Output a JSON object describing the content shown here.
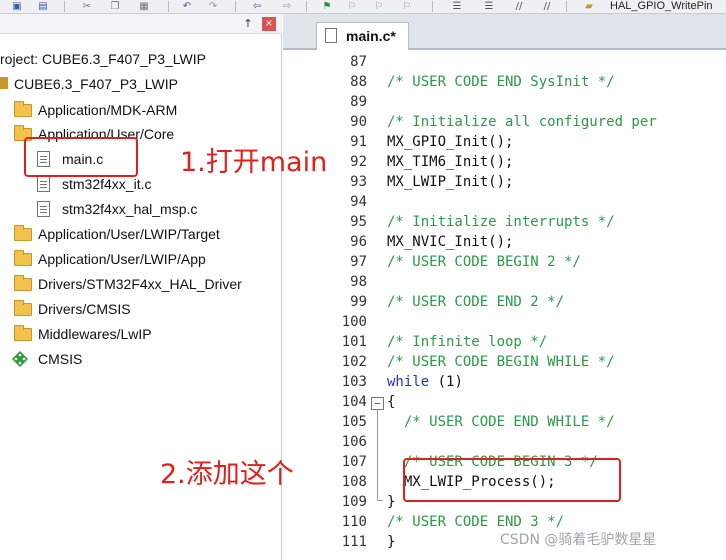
{
  "toolbar": {
    "function_label": "HAL_GPIO_WritePin",
    "icons": [
      "save-icon",
      "save-all-icon",
      "cut-icon",
      "copy-icon",
      "paste-icon",
      "undo-icon",
      "redo-icon",
      "nav-back-icon",
      "nav-forward-icon",
      "bookmark-icon",
      "bookmark-prev-icon",
      "bookmark-next-icon",
      "bookmark-clear-icon",
      "indent-icon",
      "unindent-icon",
      "comment-icon",
      "uncomment-icon",
      "find-in-files-icon"
    ]
  },
  "project_pane": {
    "pin_glyph": "↑",
    "close_glyph": "×",
    "project_title": "roject: CUBE6.3_F407_P3_LWIP",
    "target_name": "CUBE6.3_F407_P3_LWIP",
    "groups": [
      {
        "label": "Application/MDK-ARM"
      },
      {
        "label": "Application/User/Core"
      },
      {
        "label": "Application/User/LWIP/Target"
      },
      {
        "label": "Application/User/LWIP/App"
      },
      {
        "label": "Drivers/STM32F4xx_HAL_Driver"
      },
      {
        "label": "Drivers/CMSIS"
      },
      {
        "label": "Middlewares/LwIP"
      }
    ],
    "core_files": [
      {
        "label": "main.c"
      },
      {
        "label": "stm32f4xx_it.c"
      },
      {
        "label": "stm32f4xx_hal_msp.c"
      }
    ],
    "cmsis_label": "CMSIS"
  },
  "annotations": {
    "step1": "1.打开main",
    "step2": "2.添加这个"
  },
  "editor": {
    "active_tab": "main.c*",
    "fold_glyph": "−",
    "lines": [
      {
        "num": "87",
        "code": ""
      },
      {
        "num": "88",
        "code": "/* USER CODE END SysInit */"
      },
      {
        "num": "89",
        "code": ""
      },
      {
        "num": "90",
        "code": "/* Initialize all configured per"
      },
      {
        "num": "91",
        "code": "MX_GPIO_Init();"
      },
      {
        "num": "92",
        "code": "MX_TIM6_Init();"
      },
      {
        "num": "93",
        "code": "MX_LWIP_Init();"
      },
      {
        "num": "94",
        "code": ""
      },
      {
        "num": "95",
        "code": "/* Initialize interrupts */"
      },
      {
        "num": "96",
        "code": "MX_NVIC_Init();"
      },
      {
        "num": "97",
        "code": "/* USER CODE BEGIN 2 */"
      },
      {
        "num": "98",
        "code": ""
      },
      {
        "num": "99",
        "code": "/* USER CODE END 2 */"
      },
      {
        "num": "100",
        "code": ""
      },
      {
        "num": "101",
        "code": "/* Infinite loop */"
      },
      {
        "num": "102",
        "code": "/* USER CODE BEGIN WHILE */"
      },
      {
        "num": "103",
        "code": "while (1)"
      },
      {
        "num": "104",
        "code": "{"
      },
      {
        "num": "105",
        "code": "  /* USER CODE END WHILE */"
      },
      {
        "num": "106",
        "code": ""
      },
      {
        "num": "107",
        "code": "  /* USER CODE BEGIN 3 */"
      },
      {
        "num": "108",
        "code": "  MX_LWIP_Process();"
      },
      {
        "num": "109",
        "code": "}"
      },
      {
        "num": "110",
        "code": "/* USER CODE END 3 */"
      },
      {
        "num": "111",
        "code": "}"
      }
    ]
  },
  "watermark": "CSDN @骑着毛驴数星星",
  "colors": {
    "comment": "#2b9a48",
    "keyword": "#2035c9",
    "annotation_red": "#e0201b",
    "folder": "#f3c24a"
  }
}
